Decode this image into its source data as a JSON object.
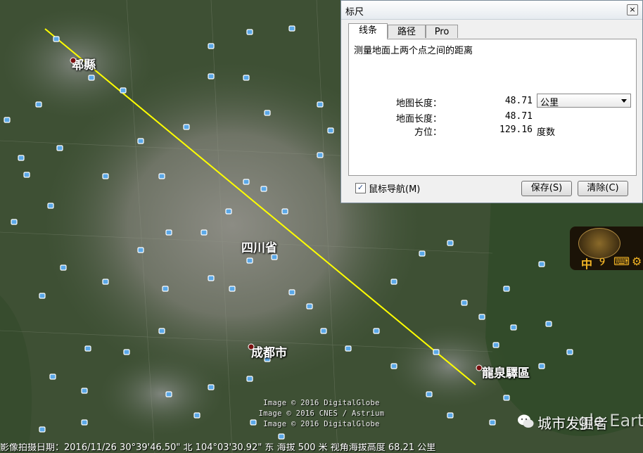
{
  "map": {
    "places": [
      {
        "id": "pixian",
        "name": "郫縣"
      },
      {
        "id": "sichuan",
        "name": "四川省"
      },
      {
        "id": "chengdu",
        "name": "成都市"
      },
      {
        "id": "longquanyi",
        "name": "龍泉驛區"
      }
    ],
    "copyright": [
      "Image © 2016 DigitalGlobe",
      "Image © 2016 CNES / Astrium",
      "Image © 2016 DigitalGlobe"
    ],
    "status_bar": "影像拍摄日期：2016/11/26   30°39'46.50\" 北 104°03'30.92\" 东 海拔   500 米   视角海拔高度   68.21 公里",
    "watermark": "城市发掘者",
    "watermark_partial": "gle Earth",
    "path_color": "#ffff00"
  },
  "ruler_dialog": {
    "title": "标尺",
    "close_glyph": "×",
    "tabs": [
      {
        "label": "线条",
        "active": true
      },
      {
        "label": "路径",
        "active": false
      },
      {
        "label": "Pro",
        "active": false
      }
    ],
    "description": "测量地面上两个点之间的距离",
    "map_length_label": "地图长度：",
    "map_length_value": "48.71",
    "unit_selected": "公里",
    "ground_length_label": "地面长度：",
    "ground_length_value": "48.71",
    "heading_label": "方位：",
    "heading_value": "129.16",
    "heading_unit": "度数",
    "mouse_nav_checked": true,
    "mouse_nav_check_glyph": "✓",
    "mouse_nav_label": "鼠标导航(M)",
    "save_label": "保存(S)",
    "clear_label": "清除(C)"
  },
  "clock_widget": {
    "tools": [
      "中",
      "୨",
      "⌨",
      "⚙"
    ],
    "accent": "#f3b526"
  }
}
